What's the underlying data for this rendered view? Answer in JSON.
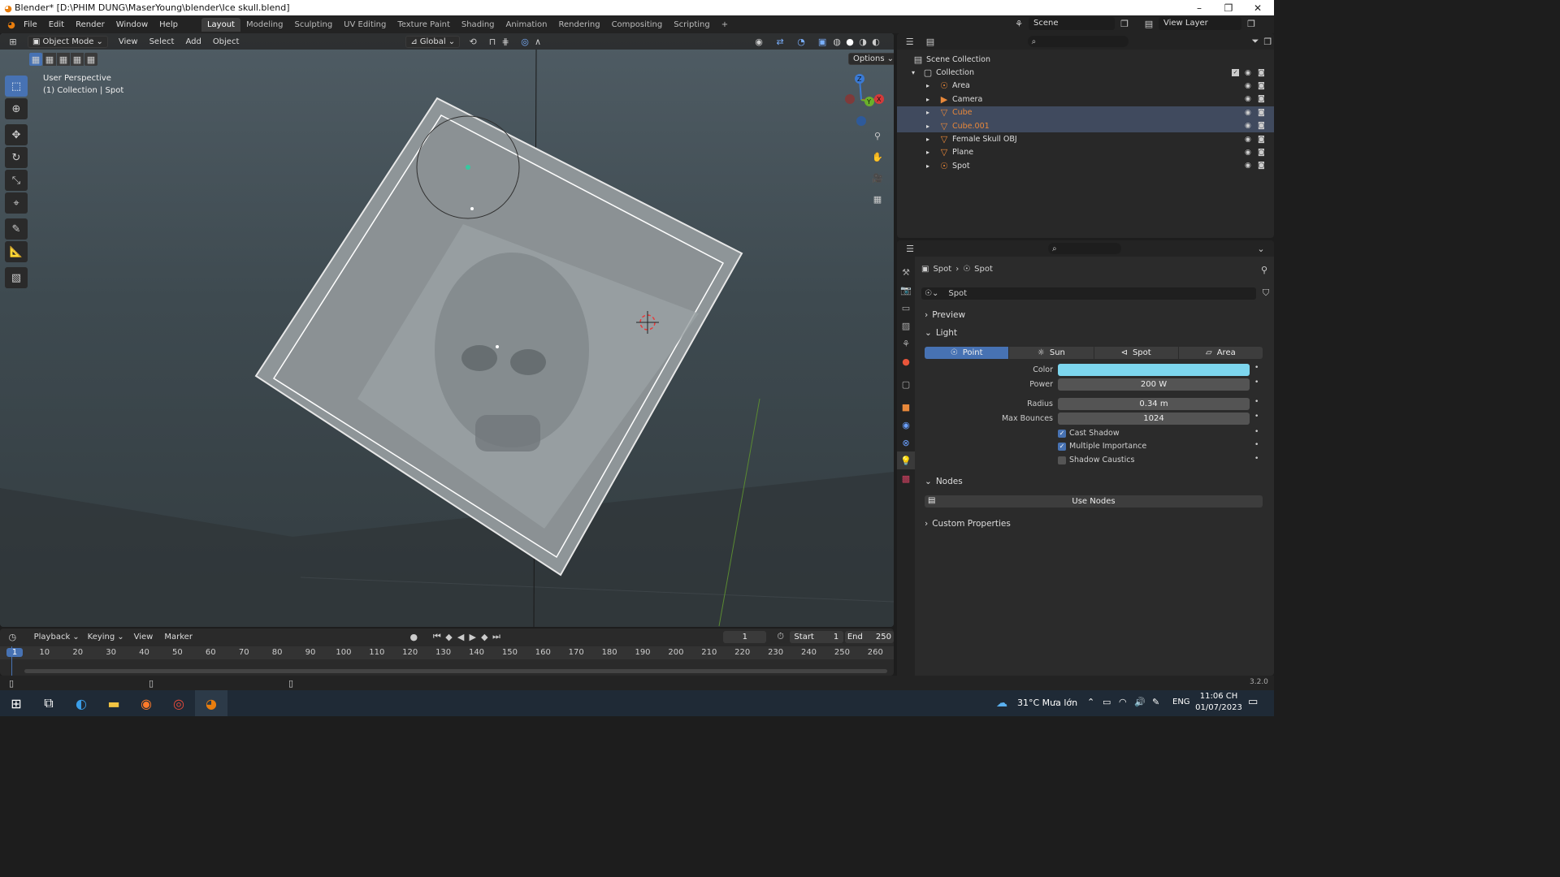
{
  "window": {
    "title": "Blender* [D:\\PHIM DUNG\\MaserYoung\\blender\\Ice skull.blend]",
    "minimize": "–",
    "maximize": "❐",
    "close": "✕"
  },
  "menus": [
    "File",
    "Edit",
    "Render",
    "Window",
    "Help"
  ],
  "workspaces": [
    {
      "label": "Layout",
      "active": true
    },
    {
      "label": "Modeling"
    },
    {
      "label": "Sculpting"
    },
    {
      "label": "UV Editing"
    },
    {
      "label": "Texture Paint"
    },
    {
      "label": "Shading"
    },
    {
      "label": "Animation"
    },
    {
      "label": "Rendering"
    },
    {
      "label": "Compositing"
    },
    {
      "label": "Scripting"
    }
  ],
  "add_workspace": "+",
  "scene": {
    "label": "Scene",
    "view_layer": "View Layer"
  },
  "viewport": {
    "mode": "Object Mode",
    "menu": [
      "View",
      "Select",
      "Add",
      "Object"
    ],
    "transform": "Global",
    "options": "Options",
    "overlay_line1": "User Perspective",
    "overlay_line2": "(1) Collection | Spot",
    "gizmo": {
      "z": "Z",
      "y": "Y",
      "x": "X"
    }
  },
  "outliner": {
    "root": "Scene Collection",
    "collection": "Collection",
    "items": [
      {
        "name": "Area",
        "selected": false,
        "color": "#dddddd"
      },
      {
        "name": "Camera",
        "selected": false,
        "color": "#dddddd"
      },
      {
        "name": "Cube",
        "selected": true,
        "color": "#e8883a"
      },
      {
        "name": "Cube.001",
        "selected": true,
        "color": "#e8883a"
      },
      {
        "name": "Female Skull OBJ",
        "selected": false,
        "color": "#dddddd"
      },
      {
        "name": "Plane",
        "selected": false,
        "color": "#dddddd"
      },
      {
        "name": "Spot",
        "selected": false,
        "color": "#dddddd"
      }
    ]
  },
  "properties": {
    "breadcrumb1": "Spot",
    "breadcrumb2": "Spot",
    "datablock": "Spot",
    "preview": "Preview",
    "light": "Light",
    "light_types": [
      "Point",
      "Sun",
      "Spot",
      "Area"
    ],
    "active_type": "Point",
    "color_label": "Color",
    "color_value": "#7dd6ee",
    "power_label": "Power",
    "power_value": "200 W",
    "radius_label": "Radius",
    "radius_value": "0.34 m",
    "bounces_label": "Max Bounces",
    "bounces_value": "1024",
    "cast_shadow": "Cast Shadow",
    "multiple_importance": "Multiple Importance",
    "shadow_caustics": "Shadow Caustics",
    "nodes": "Nodes",
    "use_nodes": "Use Nodes",
    "custom_props": "Custom Properties"
  },
  "timeline": {
    "menu": [
      "Playback",
      "Keying",
      "View",
      "Marker"
    ],
    "current_frame": "1",
    "start_label": "Start",
    "start": "1",
    "end_label": "End",
    "end": "250",
    "ticks": [
      "1",
      "10",
      "20",
      "30",
      "40",
      "50",
      "60",
      "70",
      "80",
      "90",
      "100",
      "110",
      "120",
      "130",
      "140",
      "150",
      "160",
      "170",
      "180",
      "190",
      "200",
      "210",
      "220",
      "230",
      "240",
      "250",
      "260"
    ]
  },
  "status": {
    "version": "3.2.0"
  },
  "taskbar": {
    "weather": "31°C  Mưa lớn",
    "lang": "ENG",
    "time": "11:06 CH",
    "date": "01/07/2023"
  }
}
